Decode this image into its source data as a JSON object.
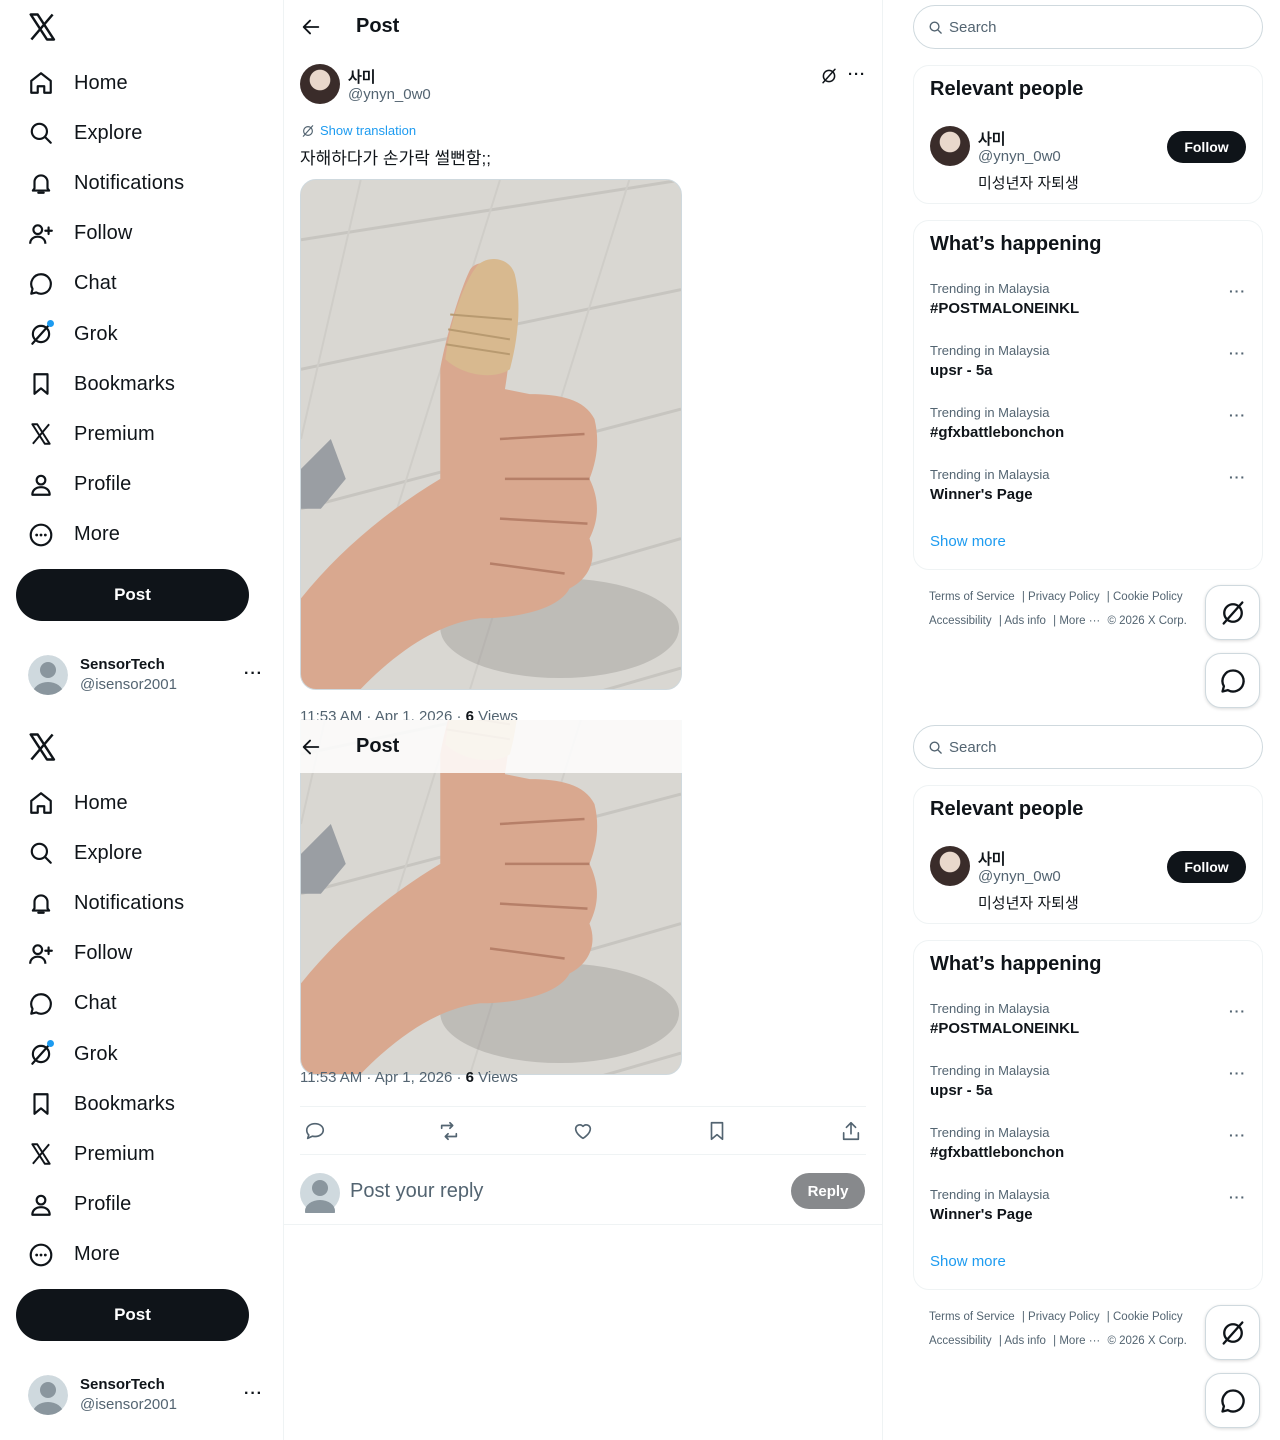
{
  "nav": {
    "items": [
      {
        "label": "Home",
        "icon": "home-icon"
      },
      {
        "label": "Explore",
        "icon": "search-icon"
      },
      {
        "label": "Notifications",
        "icon": "bell-icon"
      },
      {
        "label": "Follow",
        "icon": "person-add-icon"
      },
      {
        "label": "Chat",
        "icon": "chat-bubble-icon"
      },
      {
        "label": "Grok",
        "icon": "grok-icon"
      },
      {
        "label": "Bookmarks",
        "icon": "bookmark-icon"
      },
      {
        "label": "Premium",
        "icon": "x-logo-icon"
      },
      {
        "label": "Profile",
        "icon": "person-icon"
      },
      {
        "label": "More",
        "icon": "more-circle-icon"
      }
    ],
    "post_label": "Post"
  },
  "account": {
    "name": "SensorTech",
    "handle": "@isensor2001",
    "more": "···"
  },
  "header": {
    "title": "Post"
  },
  "post": {
    "author_name": "사미",
    "author_handle": "@ynyn_0w0",
    "show_translation": "Show translation",
    "text": "자해하다가 손가락 썰뻔함;;",
    "time": "11:53 AM · Apr 1, 2026 · ",
    "views_count": "6",
    "views_label": " Views",
    "more": "···"
  },
  "reply": {
    "placeholder": "Post your reply",
    "button": "Reply"
  },
  "search": {
    "placeholder": "Search"
  },
  "relevant": {
    "title": "Relevant people",
    "name": "사미",
    "handle": "@ynyn_0w0",
    "bio": "미성년자 자퇴생",
    "follow": "Follow"
  },
  "happening": {
    "title": "What’s happening",
    "trends": [
      {
        "context": "Trending in Malaysia",
        "name": "#POSTMALONEINKL"
      },
      {
        "context": "Trending in Malaysia",
        "name": "upsr - 5a"
      },
      {
        "context": "Trending in Malaysia",
        "name": "#gfxbattlebonchon"
      },
      {
        "context": "Trending in Malaysia",
        "name": "Winner's Page"
      }
    ],
    "show_more": "Show more",
    "more": "···"
  },
  "footer": {
    "terms": "Terms of Service",
    "privacy": "Privacy Policy",
    "cookie": "Cookie Policy",
    "accessibility": "Accessibility",
    "ads": "Ads info",
    "more": "More ···",
    "copyright": "© 2026 X Corp."
  },
  "colors": {
    "accent": "#1d9bf0",
    "text": "#0f1419",
    "muted": "#536471",
    "button_dark": "#0f1419"
  }
}
